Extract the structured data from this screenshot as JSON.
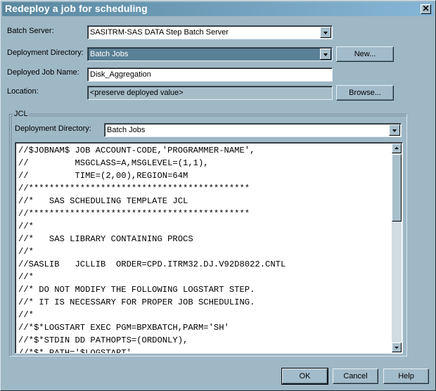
{
  "window": {
    "title": "Redeploy a job for scheduling",
    "close_icon": "close-x-icon"
  },
  "form": {
    "batch_server": {
      "label": "Batch Server:",
      "value": "SASITRM-SAS DATA Step Batch Server"
    },
    "deployment_directory": {
      "label": "Deployment Directory:",
      "value": "Batch Jobs",
      "new_button": "New..."
    },
    "deployed_job_name": {
      "label": "Deployed Job Name:",
      "value": "Disk_Aggregation"
    },
    "location": {
      "label": "Location:",
      "value": "<preserve deployed value>",
      "browse_button": "Browse..."
    }
  },
  "jcl": {
    "group_title": "JCL",
    "deployment_directory": {
      "label": "Deployment Directory:",
      "value": "Batch Jobs"
    },
    "lines": [
      "//$JOBNAM$ JOB ACCOUNT-CODE,'PROGRAMMER-NAME',",
      "//         MSGCLASS=A,MSGLEVEL=(1,1),",
      "//         TIME=(2,00),REGION=64M",
      "//*******************************************",
      "//*   SAS SCHEDULING TEMPLATE JCL",
      "//*******************************************",
      "//*",
      "//*   SAS LIBRARY CONTAINING PROCS",
      "//*",
      "//SASLIB   JCLLIB  ORDER=CPD.ITRM32.DJ.V92D8022.CNTL",
      "//*",
      "//* DO NOT MODIFY THE FOLLOWING LOGSTART STEP.",
      "//* IT IS NECESSARY FOR PROPER JOB SCHEDULING.",
      "//*",
      "//*$*LOGSTART EXEC PGM=BPXBATCH,PARM='SH'",
      "//*$*STDIN DD PATHOPTS=(ORDONLY),",
      "//*$* PATH='$LOGSTART'"
    ]
  },
  "buttons": {
    "ok": "OK",
    "cancel": "Cancel",
    "help": "Help"
  }
}
